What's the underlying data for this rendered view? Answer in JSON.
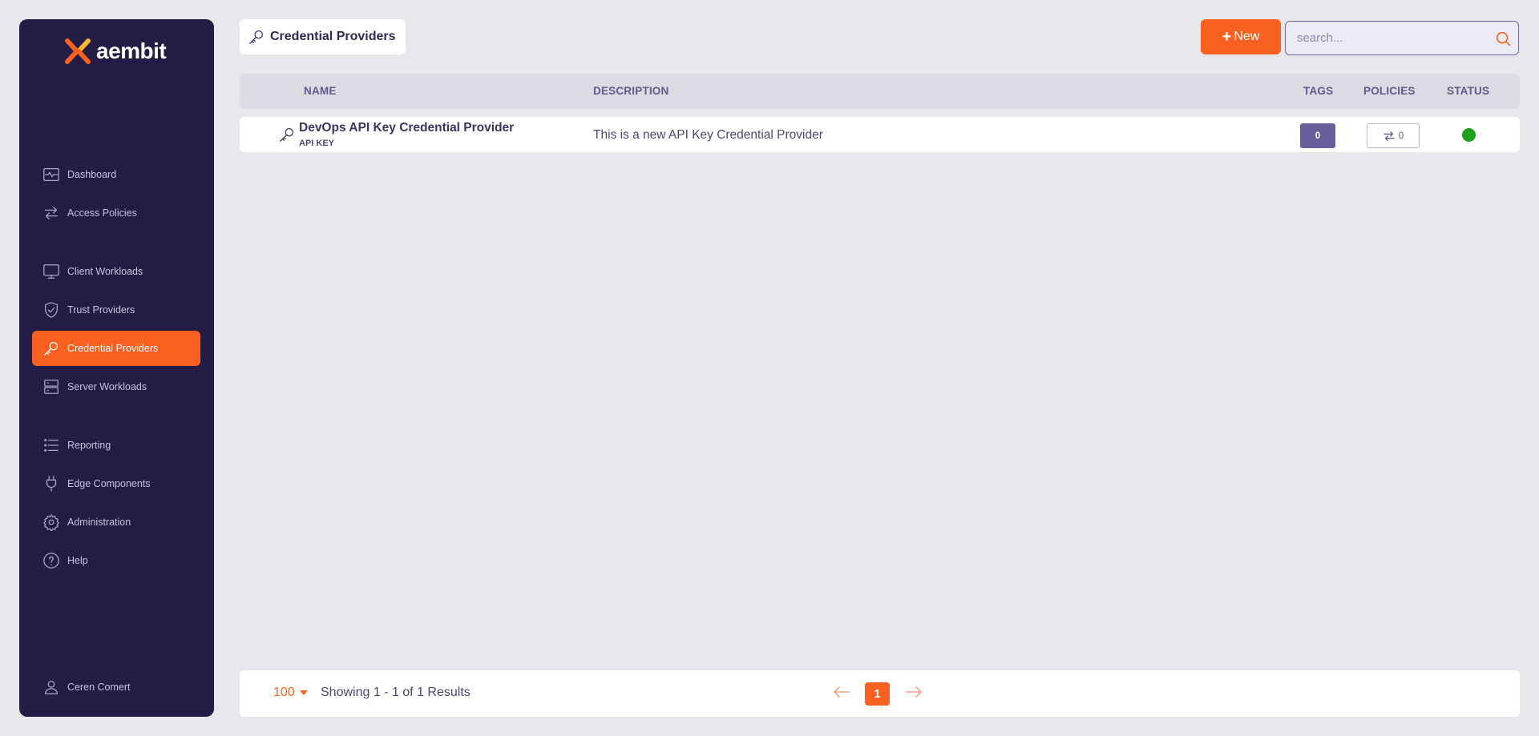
{
  "app": {
    "brand": "aembit",
    "accent_color": "#fa6121",
    "sidebar_color": "#231d45"
  },
  "sidebar": {
    "items": [
      {
        "label": "Dashboard",
        "icon": "activity-icon"
      },
      {
        "label": "Access Policies",
        "icon": "arrows-swap-icon"
      },
      {
        "label": "Client Workloads",
        "icon": "monitor-icon"
      },
      {
        "label": "Trust Providers",
        "icon": "shield-check-icon"
      },
      {
        "label": "Credential Providers",
        "icon": "key-icon",
        "active": true
      },
      {
        "label": "Server Workloads",
        "icon": "server-icon"
      },
      {
        "label": "Reporting",
        "icon": "list-icon"
      },
      {
        "label": "Edge Components",
        "icon": "plug-icon"
      },
      {
        "label": "Administration",
        "icon": "gear-icon"
      },
      {
        "label": "Help",
        "icon": "help-circle-icon"
      }
    ],
    "user": {
      "name": "Ceren Comert",
      "icon": "user-icon"
    }
  },
  "header": {
    "title": "Credential Providers",
    "title_icon": "key-icon",
    "new_button": "New",
    "search_placeholder": "search..."
  },
  "table": {
    "columns": {
      "name": "NAME",
      "description": "DESCRIPTION",
      "tags": "TAGS",
      "policies": "POLICIES",
      "status": "STATUS"
    },
    "rows": [
      {
        "name": "DevOps API Key Credential Provider",
        "type": "API KEY",
        "description": "This is a new API Key Credential Provider",
        "tags": "0",
        "policies": "0",
        "status": "active",
        "status_color": "#1ea11e"
      }
    ]
  },
  "footer": {
    "per_page": "100",
    "showing": "Showing 1 - 1 of 1 Results",
    "current_page": "1"
  }
}
